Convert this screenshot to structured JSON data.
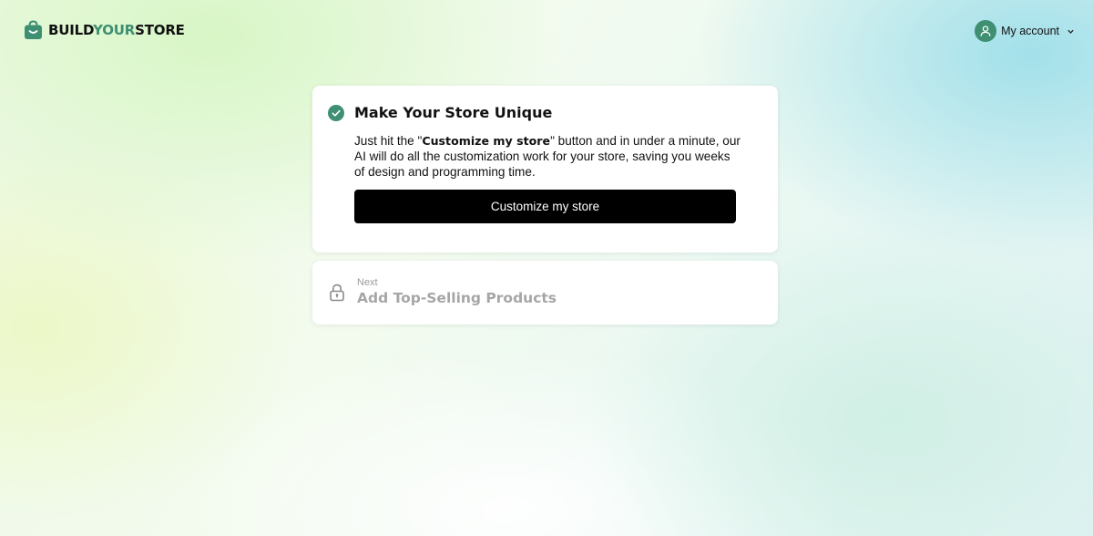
{
  "header": {
    "logo": {
      "part1": "BUILD",
      "part2": "YOUR",
      "part3": "STORE",
      "icon": "shopping-bag-icon"
    },
    "account": {
      "label": "My account",
      "avatar_icon": "user-icon",
      "chevron_icon": "chevron-down-icon"
    }
  },
  "steps": [
    {
      "status": "completed",
      "icon": "check-circle-icon",
      "title": "Make Your Store Unique",
      "description": {
        "before": "Just hit the \"",
        "bold": "Customize my store",
        "after": "\" button and in under a minute, our AI will do all the customization work for your store, saving you weeks of design and programming time."
      },
      "button_label": "Customize my store"
    },
    {
      "status": "locked",
      "icon": "lock-icon",
      "prefix": "Next",
      "title": "Add Top-Selling Products"
    }
  ],
  "colors": {
    "brand": "#3f8f72",
    "button": "#000000",
    "locked_text": "#a6a6a6"
  }
}
